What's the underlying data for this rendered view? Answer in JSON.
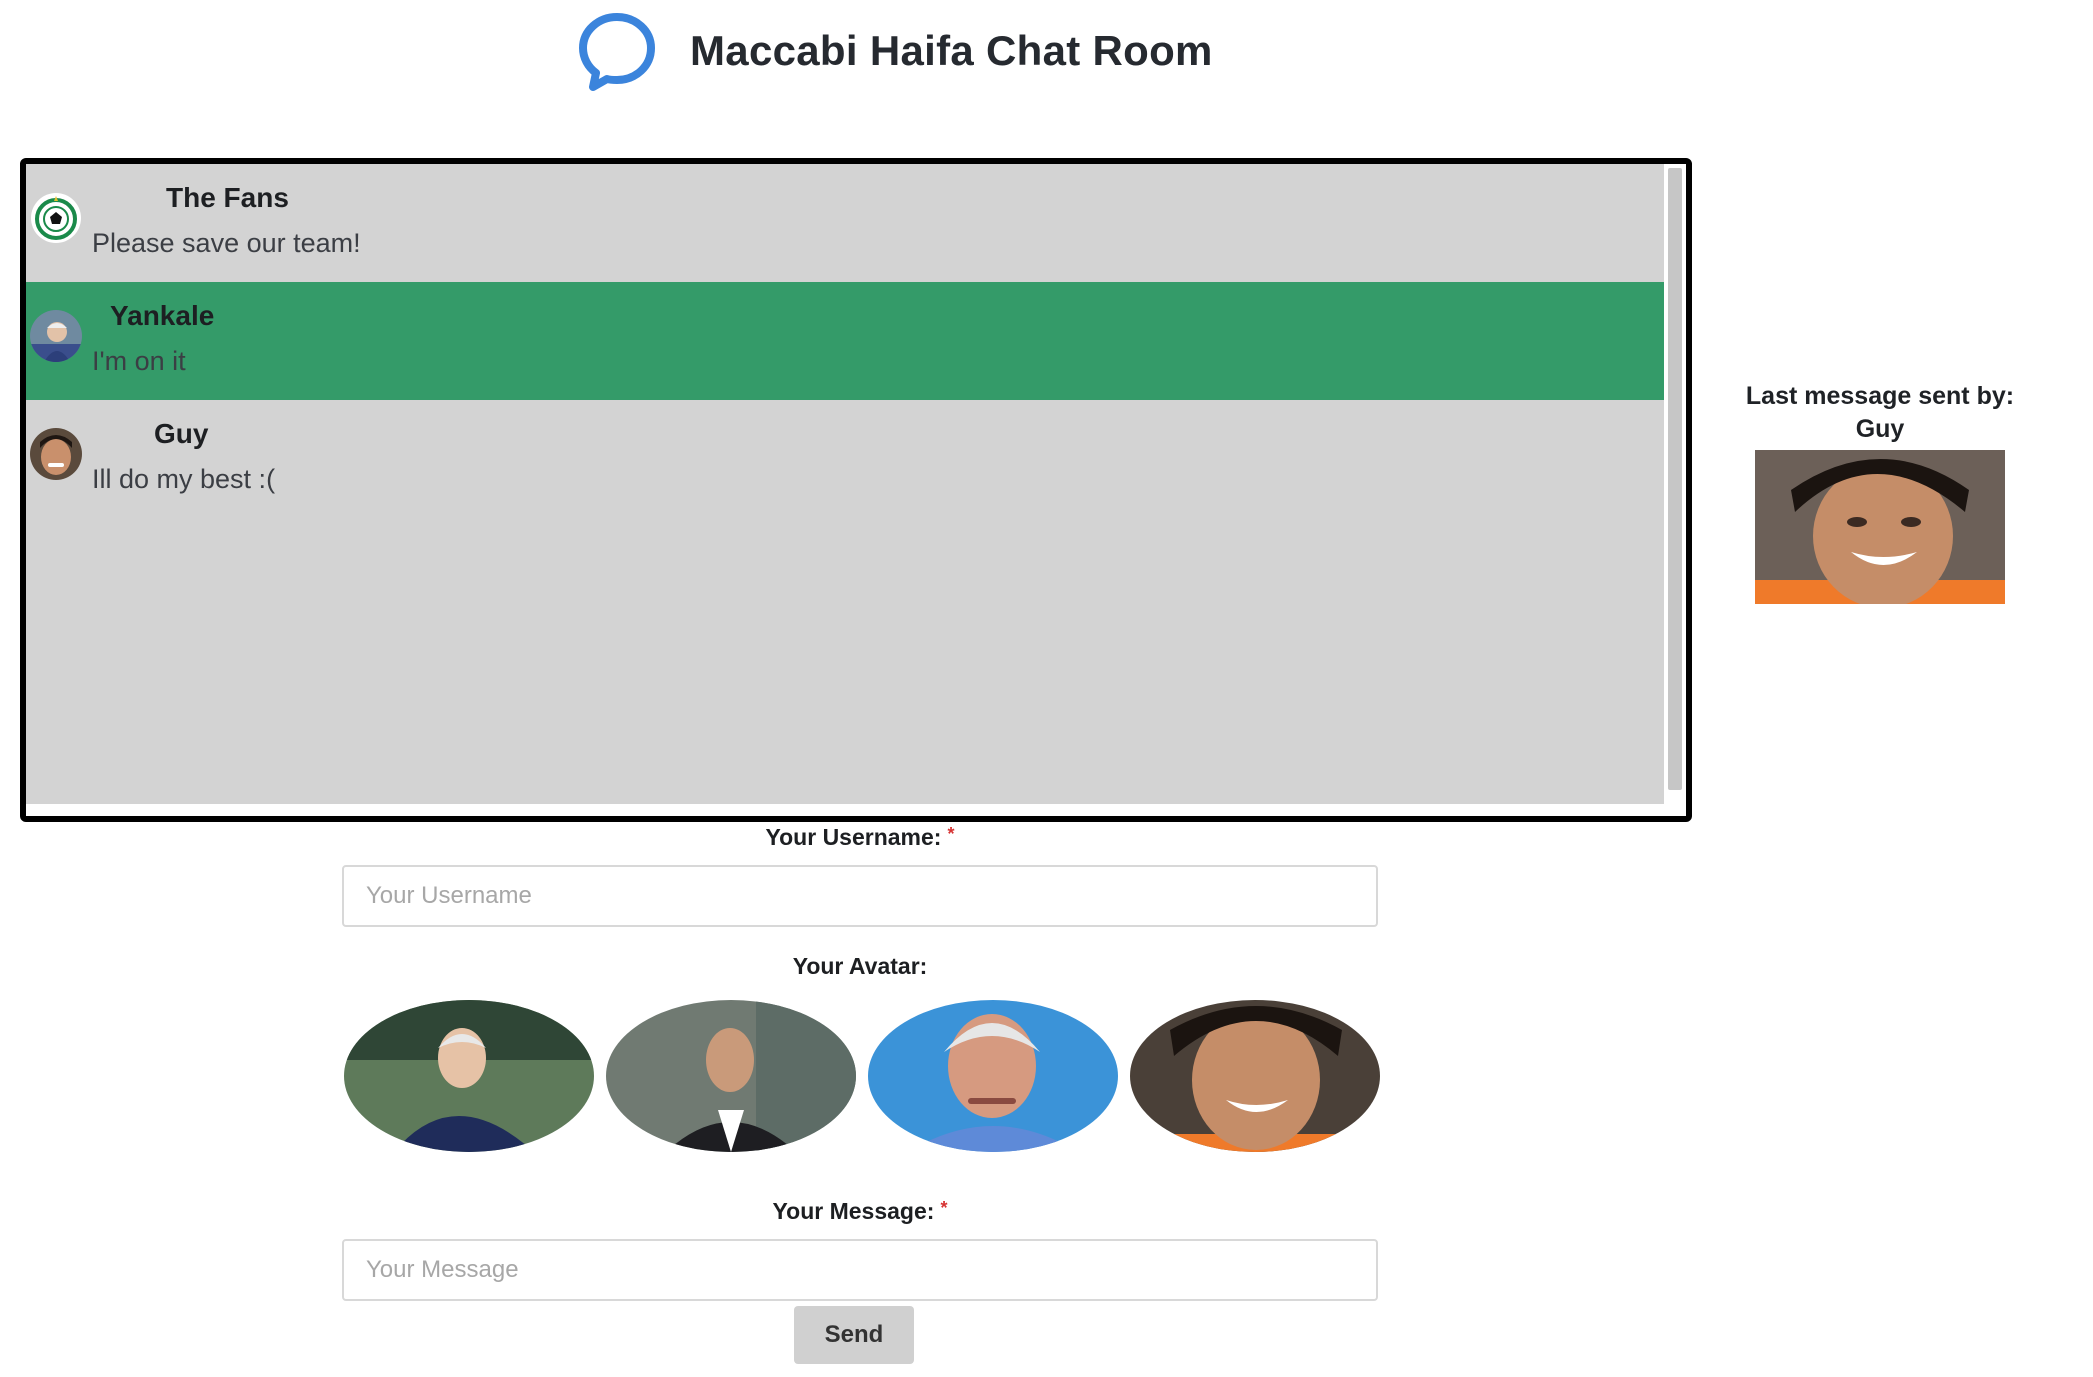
{
  "header": {
    "title": "Maccabi Haifa Chat Room",
    "logo_icon": "chat-bubble-icon",
    "accent": "#3b84dc"
  },
  "chat": {
    "highlight_color": "#349b69",
    "background": "#d3d3d3",
    "messages": [
      {
        "user": "The Fans",
        "text": "Please save our team!",
        "avatar": "club-logo-icon",
        "highlighted": false
      },
      {
        "user": "Yankale",
        "text": "I'm on it",
        "avatar": "yankale-avatar",
        "highlighted": true
      },
      {
        "user": "Guy",
        "text": "Ill do my best :(",
        "avatar": "guy-avatar",
        "highlighted": false
      }
    ]
  },
  "side": {
    "label": "Last message sent by:",
    "name": "Guy"
  },
  "form": {
    "username_label": "Your Username:",
    "username_placeholder": "Your Username",
    "username_value": "",
    "required_mark": "*",
    "avatar_label": "Your Avatar:",
    "avatars": [
      "avatar-option-1",
      "avatar-option-2",
      "avatar-option-3",
      "avatar-option-4"
    ],
    "message_label": "Your Message:",
    "message_placeholder": "Your Message",
    "message_value": "",
    "send_label": "Send"
  }
}
